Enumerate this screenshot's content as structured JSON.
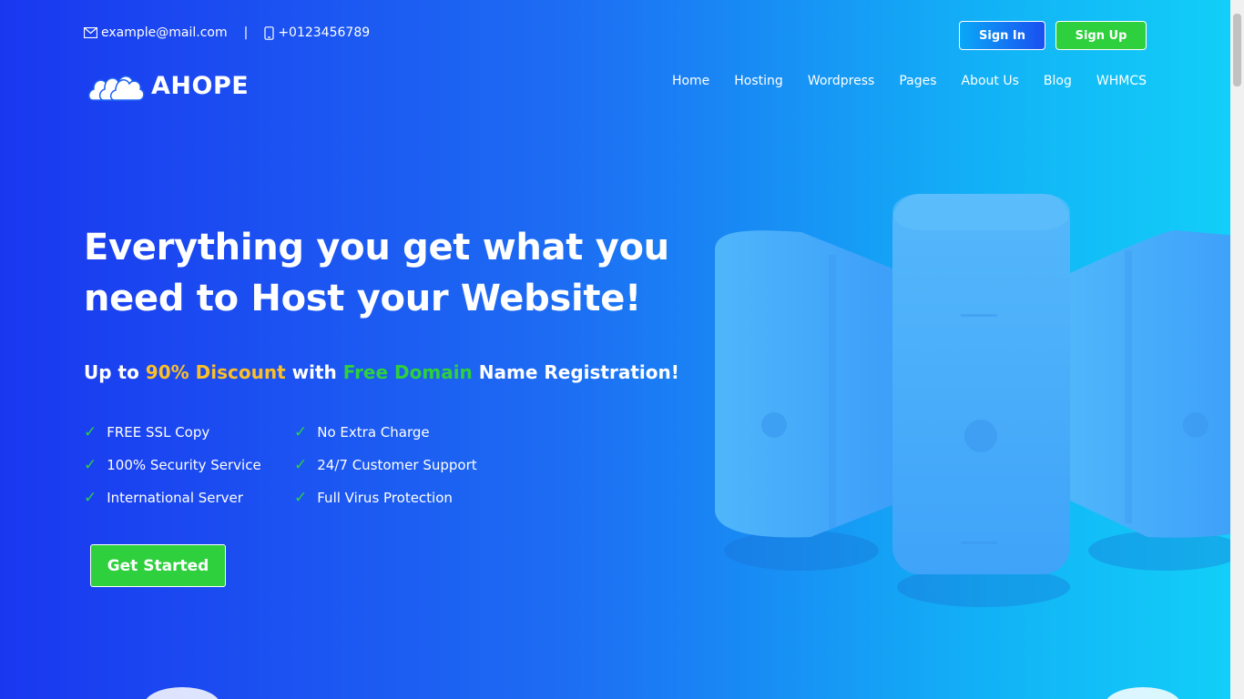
{
  "contact": {
    "email": "example@mail.com",
    "separator": "|",
    "phone": "+0123456789"
  },
  "auth": {
    "signin_label": "Sign In",
    "signup_label": "Sign Up"
  },
  "logo": {
    "text": "AHOPE",
    "icon": "cloud-icon"
  },
  "nav": {
    "items": [
      "Home",
      "Hosting",
      "Wordpress",
      "Pages",
      "About Us",
      "Blog",
      "WHMCS"
    ]
  },
  "hero": {
    "title_line1": "Everything you get what you",
    "title_line2": "need to Host your Website!",
    "subtitle": {
      "part1": "Up to ",
      "discount": "90% Discount",
      "part2": " with ",
      "free_domain": "Free Domain",
      "part3": " Name Registration!"
    },
    "features": [
      "FREE SSL Copy",
      "No Extra Charge",
      "100% Security Service",
      "24/7 Customer Support",
      "International Server",
      "Full Virus Protection"
    ],
    "cta_label": "Get Started"
  },
  "colors": {
    "accent_green": "#2ed03d",
    "accent_yellow": "#fbbf28",
    "gradient_start": "#1a37f0",
    "gradient_end": "#12d0f8"
  }
}
